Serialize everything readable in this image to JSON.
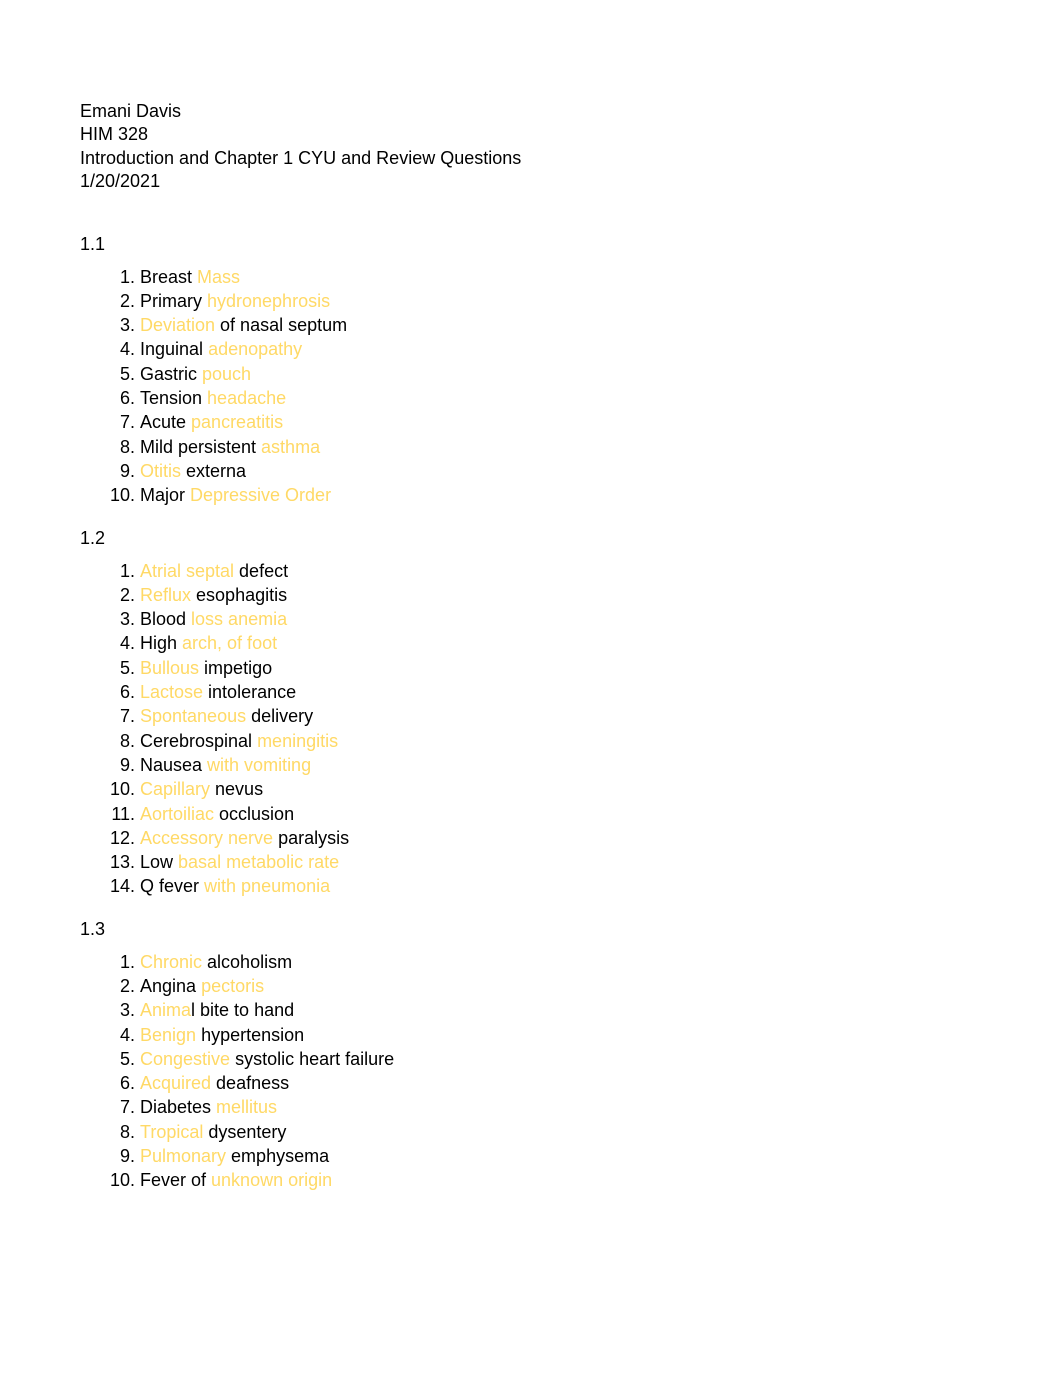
{
  "header": {
    "name": "Emani Davis",
    "course": "HIM 328",
    "title": "Introduction and Chapter 1 CYU and Review Questions",
    "date": "1/20/2021"
  },
  "sections": [
    {
      "label": "1.1",
      "items": [
        [
          {
            "t": "Breast ",
            "h": false
          },
          {
            "t": "Mass",
            "h": true
          }
        ],
        [
          {
            "t": "Primary ",
            "h": false
          },
          {
            "t": "hydronephrosis",
            "h": true
          }
        ],
        [
          {
            "t": "Deviation",
            "h": true
          },
          {
            "t": " of nasal septum",
            "h": false
          }
        ],
        [
          {
            "t": "Inguinal ",
            "h": false
          },
          {
            "t": "adenopathy",
            "h": true
          }
        ],
        [
          {
            "t": "Gastric ",
            "h": false
          },
          {
            "t": "pouch",
            "h": true
          }
        ],
        [
          {
            "t": "Tension ",
            "h": false
          },
          {
            "t": "headache",
            "h": true
          }
        ],
        [
          {
            "t": "Acute ",
            "h": false
          },
          {
            "t": "pancreatitis",
            "h": true
          }
        ],
        [
          {
            "t": "Mild persistent ",
            "h": false
          },
          {
            "t": "asthma",
            "h": true
          }
        ],
        [
          {
            "t": "Otitis",
            "h": true
          },
          {
            "t": " externa",
            "h": false
          }
        ],
        [
          {
            "t": "Major ",
            "h": false
          },
          {
            "t": "Depressive Order",
            "h": true
          }
        ]
      ]
    },
    {
      "label": "1.2",
      "items": [
        [
          {
            "t": "Atrial septal",
            "h": true
          },
          {
            "t": " defect",
            "h": false
          }
        ],
        [
          {
            "t": "Reflux",
            "h": true
          },
          {
            "t": " esophagitis",
            "h": false
          }
        ],
        [
          {
            "t": "Blood ",
            "h": false
          },
          {
            "t": "loss anemia",
            "h": true
          }
        ],
        [
          {
            "t": "High ",
            "h": false
          },
          {
            "t": "arch, of foot",
            "h": true
          }
        ],
        [
          {
            "t": "Bullous",
            "h": true
          },
          {
            "t": " impetigo",
            "h": false
          }
        ],
        [
          {
            "t": "Lactose",
            "h": true
          },
          {
            "t": " intolerance",
            "h": false
          }
        ],
        [
          {
            "t": "Spontaneous",
            "h": true
          },
          {
            "t": " delivery",
            "h": false
          }
        ],
        [
          {
            "t": "Cerebrospinal ",
            "h": false
          },
          {
            "t": "meningitis",
            "h": true
          }
        ],
        [
          {
            "t": "Nausea ",
            "h": false
          },
          {
            "t": "with vomiting",
            "h": true
          }
        ],
        [
          {
            "t": "Capillary",
            "h": true
          },
          {
            "t": " nevus",
            "h": false
          }
        ],
        [
          {
            "t": "Aortoiliac",
            "h": true
          },
          {
            "t": " occlusion",
            "h": false
          }
        ],
        [
          {
            "t": "Accessory nerve",
            "h": true
          },
          {
            "t": " paralysis",
            "h": false
          }
        ],
        [
          {
            "t": "Low ",
            "h": false
          },
          {
            "t": "basal metabolic rate",
            "h": true
          }
        ],
        [
          {
            "t": "Q fever ",
            "h": false
          },
          {
            "t": "with pneumonia",
            "h": true
          }
        ]
      ]
    },
    {
      "label": "1.3",
      "items": [
        [
          {
            "t": "Chronic",
            "h": true
          },
          {
            "t": " alcoholism",
            "h": false
          }
        ],
        [
          {
            "t": "Angina ",
            "h": false
          },
          {
            "t": "pectoris",
            "h": true
          }
        ],
        [
          {
            "t": "Anima",
            "h": true
          },
          {
            "t": "l bite to hand",
            "h": false
          }
        ],
        [
          {
            "t": "Benign",
            "h": true
          },
          {
            "t": " hypertension",
            "h": false
          }
        ],
        [
          {
            "t": "Congestive",
            "h": true
          },
          {
            "t": " systolic heart failure",
            "h": false
          }
        ],
        [
          {
            "t": "Acquired",
            "h": true
          },
          {
            "t": " deafness",
            "h": false
          }
        ],
        [
          {
            "t": "Diabetes ",
            "h": false
          },
          {
            "t": "mellitus",
            "h": true
          }
        ],
        [
          {
            "t": "Tropical",
            "h": true
          },
          {
            "t": " dysentery",
            "h": false
          }
        ],
        [
          {
            "t": "Pulmonary",
            "h": true
          },
          {
            "t": " emphysema",
            "h": false
          }
        ],
        [
          {
            "t": "Fever of ",
            "h": false
          },
          {
            "t": "unknown origin",
            "h": true
          }
        ]
      ]
    }
  ]
}
